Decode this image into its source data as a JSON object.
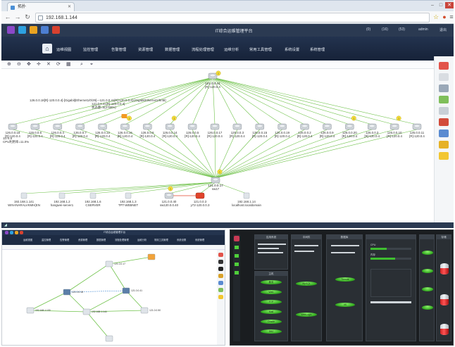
{
  "browser": {
    "tab_title": "拓扑",
    "url": "192.168.1.144"
  },
  "app": {
    "title": "IT综合运维管理平台",
    "header_right": [
      "(0)",
      "(16)",
      "(53)",
      "admin",
      "退出"
    ],
    "menu": [
      "运维视图",
      "监控管理",
      "告警管理",
      "资源管理",
      "数据管理",
      "流程处理管理",
      "运维分析",
      "常用工具管理",
      "系统设置",
      "系统管理"
    ]
  },
  "top_topology": {
    "top_node": {
      "ip": "121.0.0.41",
      "model": "[R]-120.0.4"
    },
    "hub_node": {
      "ip": "121.0.0.17",
      "model": "sw17"
    },
    "link_note": [
      "126.0.0.18[R]-120.0.0.4]-[Gigabit]Ethernet1/0/29]---121.0.0.41[R]-120.0.0.4]-[GigabitEthernet1/0/48]",
      "121.0.0.41[R]-120.0.0.4]",
      "状态量=0(2798%)"
    ],
    "row_nodes": [
      {
        "ip": "126.0.0.18",
        "model": "[R]-120.0.4"
      },
      {
        "ip": "126.0.0.6",
        "model": "[R]-120.0.4"
      },
      {
        "ip": "126.0.0.4",
        "model": "[R]-120.0.4"
      },
      {
        "ip": "126.0.0.7",
        "model": "[R]-120.0.4"
      },
      {
        "ip": "126.0.0.12",
        "model": "[R]-120.0.4"
      },
      {
        "ip": "126.0.0.16",
        "model": "[R]-120.0.4"
      },
      {
        "ip": "126.0.0.8",
        "model": "[R]-120.0.4"
      },
      {
        "ip": "126.0.0.14",
        "model": "[R]-120.0.4"
      },
      {
        "ip": "126.0.0.5",
        "model": "[R]-120.0.4"
      },
      {
        "ip": "126.0.0.17",
        "model": "[R]-120.0.4"
      },
      {
        "ip": "126.0.0.3",
        "model": "[R]-120.0.4"
      },
      {
        "ip": "126.0.0.15",
        "model": "[R]-120.0.4"
      },
      {
        "ip": "126.0.0.19",
        "model": "[R]-120.0.4"
      },
      {
        "ip": "126.0.0.2",
        "model": "[R]-120.0.4"
      },
      {
        "ip": "126.0.0.9",
        "model": "[R]-120.0.4"
      },
      {
        "ip": "126.0.0.20",
        "model": "[R]-120.0.4"
      },
      {
        "ip": "126.0.0.3",
        "model": "[R]-120.0.4"
      },
      {
        "ip": "126.0.0.10",
        "model": "[R]-120.0.4"
      },
      {
        "ip": "126.0.0.11",
        "model": "[R]-120.0.4"
      }
    ],
    "first_node_extra": [
      "1174.5",
      "CPU利用率=11.0%"
    ],
    "bottom_nodes": [
      {
        "ip": "192.168.1.141",
        "name": "WIN-INARALVKMH(EN"
      },
      {
        "ip": "192.168.1.2",
        "name": "hangwei-server1"
      },
      {
        "ip": "192.168.1.6",
        "name": "CSERVER"
      },
      {
        "ip": "192.168.1.3",
        "name": "TPT-WEBNET"
      },
      {
        "ip": "121.0.0.40",
        "name": "sw120.0.0.40"
      },
      {
        "ip": "121.0.0.3",
        "name": "y72-120.0.0.3"
      },
      {
        "ip": "192.168.1.14",
        "name": "localhost.localdomain"
      }
    ],
    "alarm_badge": "1"
  },
  "bottom_left": {
    "title": "IT综合运维管理平台",
    "menu": [
      "运维视图",
      "监控管理",
      "告警管理",
      "资源管理",
      "数据管理",
      "流程处理管理",
      "运维分析",
      "常用工具管理",
      "系统设置",
      "系统管理"
    ],
    "node_labels": [
      "121.0.0.17",
      "121.0.0.18",
      "121.0.0.41",
      "192.168.1.130",
      "192.168.1.144",
      "121.0.0.50"
    ]
  },
  "bottom_right": {
    "panels": [
      "应用系统",
      "主机",
      "中间件",
      "数据库",
      "存储"
    ],
    "pills": [
      "服务",
      "Web",
      "FTP",
      "Mail",
      "Oracle",
      "DB2",
      "MySQL",
      "WebLogic",
      "Tomcat",
      "IIS"
    ],
    "cpu_label": "CPU",
    "mem_label": "内存"
  }
}
